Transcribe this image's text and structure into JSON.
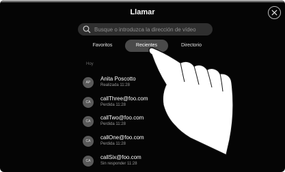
{
  "header": {
    "title": "Llamar"
  },
  "close": {
    "icon": "close-icon"
  },
  "search": {
    "placeholder": "Busque o introduzca la dirección de vídeo",
    "icon": "search-icon"
  },
  "tabs": [
    {
      "label": "Favoritos"
    },
    {
      "label": "Recientes",
      "selected": true
    },
    {
      "label": "Directorio"
    }
  ],
  "section": {
    "label": "Hoy"
  },
  "calls": [
    {
      "initials": "AP",
      "name": "Anita Poscotto",
      "status": "Realizada 11:28"
    },
    {
      "initials": "CA",
      "name": "callThree@foo.com",
      "status": "Perdida 11:28"
    },
    {
      "initials": "CA",
      "name": "callTwo@foo.com",
      "status": "Perdida 11:28"
    },
    {
      "initials": "CA",
      "name": "callOne@foo.com",
      "status": "Perdida 11:28"
    },
    {
      "initials": "CA",
      "name": "callSix@foo.com",
      "status": "Sin responder 11:28"
    }
  ],
  "colors": {
    "background": "#050505",
    "selected_tab": "#4a4a4a",
    "search_field": "#2f2f2f"
  }
}
